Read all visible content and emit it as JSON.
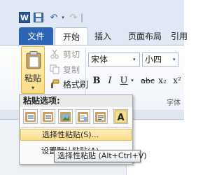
{
  "quick_access": {
    "app_icon": "word-icon",
    "app_letter": "W",
    "save_icon": "save-icon",
    "undo_icon": "undo-icon",
    "undo_glyph": "↶",
    "dropdown_glyph": "▾",
    "redo_icon": "redo-icon",
    "redo_glyph": "↷",
    "separator_glyph": "|"
  },
  "tabs": [
    {
      "label": "文件",
      "active": false,
      "accent": "#2c64b6"
    },
    {
      "label": "开始",
      "active": true
    },
    {
      "label": "插入",
      "active": false
    },
    {
      "label": "页面布局",
      "active": false
    },
    {
      "label": "引用",
      "active": false
    }
  ],
  "clipboard": {
    "paste_label": "粘贴",
    "paste_arrow": "▾",
    "cut_label": "剪切",
    "copy_label": "复制",
    "format_painter_label": "格式刷"
  },
  "font": {
    "font_name": "宋体",
    "font_size": "小四",
    "dropdown_glyph": "▾",
    "bold": "B",
    "italic": "I",
    "underline": "U",
    "strikethrough": "abc",
    "subscript": "x₂",
    "superscript": "x²",
    "group_label": "字体"
  },
  "paste_menu": {
    "header": "粘贴选项:",
    "option_icons": [
      "paste-keep-source-icon",
      "paste-merge-format-icon",
      "paste-picture-icon",
      "paste-keep-text-only-icon",
      "paste-text-icon",
      "paste-text-a-icon"
    ],
    "paste_special": "选择性粘贴(S)...",
    "set_default": "设置默认粘贴(A)..."
  },
  "tooltip": {
    "text": "选择性粘贴 (Alt+Ctrl+V)"
  },
  "colors": {
    "ribbon_bg": "#dfe8f4",
    "file_tab": "#2c64b6",
    "highlight": "#fbdc85",
    "word_blue": "#2b579a"
  }
}
